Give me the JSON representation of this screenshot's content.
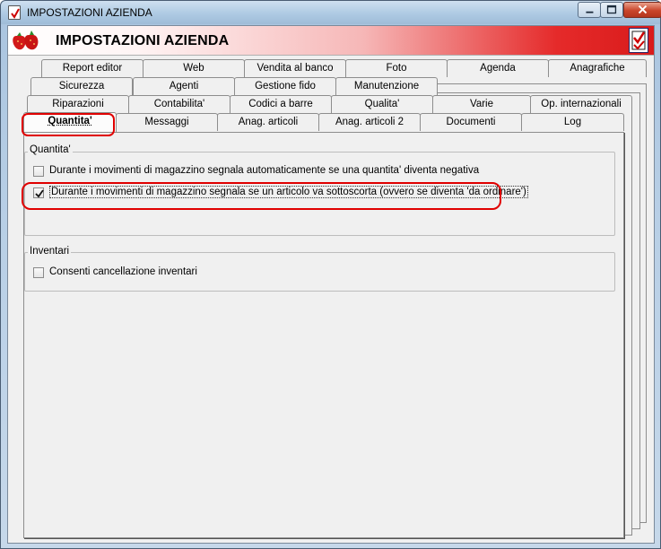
{
  "window": {
    "title": "IMPOSTAZIONI AZIENDA"
  },
  "header": {
    "title": "IMPOSTAZIONI AZIENDA"
  },
  "tabs": {
    "row1": [
      "Report editor",
      "Web",
      "Vendita al banco",
      "Foto",
      "Agenda",
      "Anagrafiche"
    ],
    "row2": [
      "Sicurezza",
      "Agenti",
      "Gestione fido",
      "Manutenzione"
    ],
    "row3": [
      "Riparazioni",
      "Contabilita'",
      "Codici a barre",
      "Qualita'",
      "Varie",
      "Op. internazionali"
    ],
    "row4": [
      "Quantita'",
      "Messaggi",
      "Anag. articoli",
      "Anag. articoli 2",
      "Documenti",
      "Log"
    ],
    "active": "Quantita'"
  },
  "groups": {
    "quantita": {
      "label": "Quantita'",
      "options": [
        {
          "label": "Durante i movimenti di magazzino segnala automaticamente se una quantita' diventa negativa",
          "checked": false
        },
        {
          "label": "Durante i movimenti di magazzino segnala se un articolo va sottoscorta (ovvero se diventa 'da ordinare')",
          "checked": true
        }
      ]
    },
    "inventari": {
      "label": "Inventari",
      "options": [
        {
          "label": "Consenti cancellazione inventari",
          "checked": false
        }
      ]
    }
  },
  "colors": {
    "highlight": "#e00000",
    "header_red": "#d91b1b"
  }
}
